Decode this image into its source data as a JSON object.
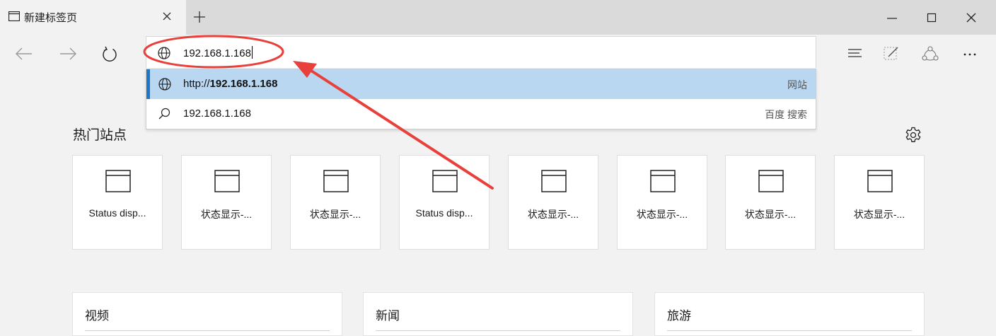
{
  "tab": {
    "title": "新建标签页",
    "icon": "page-icon"
  },
  "address": {
    "value": "192.168.1.168",
    "icon": "globe-icon"
  },
  "suggestions": [
    {
      "prefix": "http://",
      "bold": "192.168.1.168",
      "tag": "网站",
      "icon": "globe-icon"
    },
    {
      "text": "192.168.1.168",
      "tag": "百度 搜索",
      "icon": "search-icon"
    }
  ],
  "top_sites": {
    "title": "热门站点",
    "tiles": [
      {
        "label": "Status disp..."
      },
      {
        "label": "状态显示-..."
      },
      {
        "label": "状态显示-..."
      },
      {
        "label": "Status disp..."
      },
      {
        "label": "状态显示-..."
      },
      {
        "label": "状态显示-..."
      },
      {
        "label": "状态显示-..."
      },
      {
        "label": "状态显示-..."
      }
    ]
  },
  "cards": [
    {
      "title": "视频"
    },
    {
      "title": "新闻"
    },
    {
      "title": "旅游"
    }
  ],
  "colors": {
    "accent": "#1e77c7",
    "selection": "#b9d7f1",
    "annotation": "#e8403a"
  }
}
